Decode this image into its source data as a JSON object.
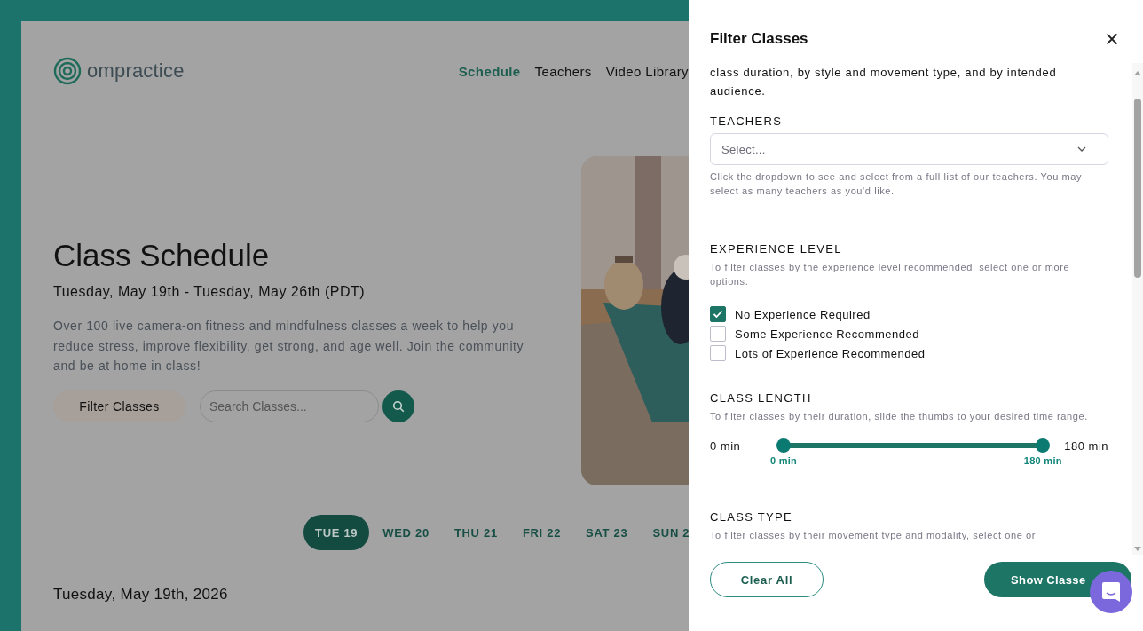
{
  "site": {
    "logo": "ompractice",
    "nav": [
      {
        "label": "Schedule",
        "selected": true
      },
      {
        "label": "Teachers",
        "selected": false
      },
      {
        "label": "Video Library",
        "selected": false
      }
    ]
  },
  "hero": {
    "title": "Class Schedule",
    "dates": "Tuesday, May 19th - Tuesday, May 26th (PDT)",
    "description": "Over 100 live camera-on fitness and mindfulness classes a week to help you reduce stress, improve flexibility, get strong, and age well. Join the community and be at home in class!",
    "filter_button": "Filter Classes",
    "search": {
      "placeholder": "Search Classes..."
    }
  },
  "days": [
    {
      "label": "TUE 19",
      "selected": true
    },
    {
      "label": "WED 20",
      "selected": false
    },
    {
      "label": "THU 21",
      "selected": false
    },
    {
      "label": "FRI 22",
      "selected": false
    },
    {
      "label": "SAT 23",
      "selected": false
    },
    {
      "label": "SUN 2",
      "selected": false
    }
  ],
  "day_heading": "Tuesday, May 19th, 2026",
  "drawer": {
    "title": "Filter Classes",
    "intro": "class duration, by style and movement type, and by intended audience.",
    "teachers": {
      "heading": "TEACHERS",
      "placeholder": "Select...",
      "help": "Click the dropdown to see and select from a full list of our teachers. You may select as many teachers as you'd like."
    },
    "experience": {
      "heading": "EXPERIENCE LEVEL",
      "help": "To filter classes by the experience level recommended, select one or more options.",
      "options": [
        {
          "label": "No Experience Required",
          "checked": true
        },
        {
          "label": "Some Experience Recommended",
          "checked": false
        },
        {
          "label": "Lots of Experience Recommended",
          "checked": false
        }
      ]
    },
    "length": {
      "heading": "CLASS LENGTH",
      "help": "To filter classes by their duration, slide the thumbs to your desired time range.",
      "min_label": "0 min",
      "max_label": "180 min",
      "thumbs": [
        {
          "level": 0,
          "label": "0 min"
        },
        {
          "level": 1,
          "label": "180 min"
        }
      ]
    },
    "class_type": {
      "heading": "CLASS TYPE",
      "help": "To filter classes by their movement type and modality, select one or"
    },
    "clear_button": "Clear All",
    "show_button": "Show Classe"
  }
}
